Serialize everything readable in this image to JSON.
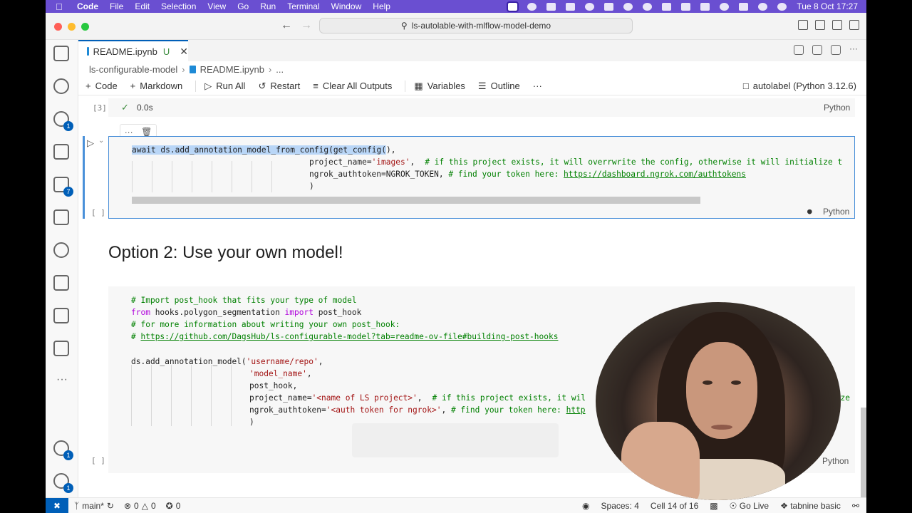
{
  "menubar": {
    "app": "Code",
    "items": [
      "File",
      "Edit",
      "Selection",
      "View",
      "Go",
      "Run",
      "Terminal",
      "Window",
      "Help"
    ],
    "datetime": "Tue 8 Oct  17:27"
  },
  "titlebar": {
    "search_text": "ls-autolable-with-mlflow-model-demo"
  },
  "activity_badges": {
    "source_control": "1",
    "extensions": "7",
    "accounts": "1",
    "settings": "1"
  },
  "tab": {
    "label": "README.ipynb",
    "status": "U",
    "close": "✕"
  },
  "breadcrumb": {
    "folder": "ls-configurable-model",
    "file": "README.ipynb",
    "more": "..."
  },
  "toolbar": {
    "code": "Code",
    "markdown": "Markdown",
    "run_all": "Run All",
    "restart": "Restart",
    "clear_outputs": "Clear All Outputs",
    "variables": "Variables",
    "outline": "Outline",
    "more": "···",
    "kernel": "autolabel (Python 3.12.6)"
  },
  "prev_cell": {
    "exec_count": "[3]",
    "time": "0.0s",
    "lang": "Python"
  },
  "cell1": {
    "exec_count": "[ ]",
    "lang": "Python",
    "toolbar_more": "···",
    "line1_selected": "await ds.add_annotation_model_from_config(get_config(",
    "line1_rest": "),",
    "line2_arg": "project_name=",
    "line2_str": "'images'",
    "line2_comma": ",",
    "line2_comment": "# if this project exists, it will overrwrite the config, otherwise it will initialize t",
    "line3_arg": "ngrok_authtoken=NGROK_TOKEN,",
    "line3_comment": "# find your token here: ",
    "line3_link": "https://dashboard.ngrok.com/authtokens",
    "line4": ")"
  },
  "markdown": {
    "heading": "Option 2: Use your own model!"
  },
  "cell2": {
    "exec_count": "[ ]",
    "lang": "Python",
    "l1": "# Import post_hook that fits your type of model",
    "l2_from": "from",
    "l2_mod": " hooks.polygon_segmentation ",
    "l2_import": "import",
    "l2_name": " post_hook",
    "l3": "# for more information about writing your own post_hook:",
    "l4_prefix": "# ",
    "l4_link": "https://github.com/DagsHub/ls-configurable-model?tab=readme-ov-file#building-post-hooks",
    "l6_call": "ds.add_annotation_model(",
    "l6_str": "'username/repo'",
    "l6_comma": ",",
    "l7_str": "'model_name'",
    "l7_comma": ",",
    "l8": "post_hook,",
    "l9_arg": "project_name=",
    "l9_str": "'<name of LS project>'",
    "l9_comma": ",",
    "l9_comment": "# if this project exists, it wil",
    "l9_tail": "lize",
    "l10_arg": "ngrok_authtoken=",
    "l10_str": "'<auth token for ngrok>'",
    "l10_comma": ",",
    "l10_comment": "# find your token here: ",
    "l10_link": "http",
    "l11": ")"
  },
  "statusbar": {
    "branch": "main*",
    "errors": "0",
    "warnings": "0",
    "ports": "0",
    "spaces": "Spaces: 4",
    "cell": "Cell 14 of 16",
    "golive": "Go Live",
    "tabnine": "tabnine basic"
  }
}
